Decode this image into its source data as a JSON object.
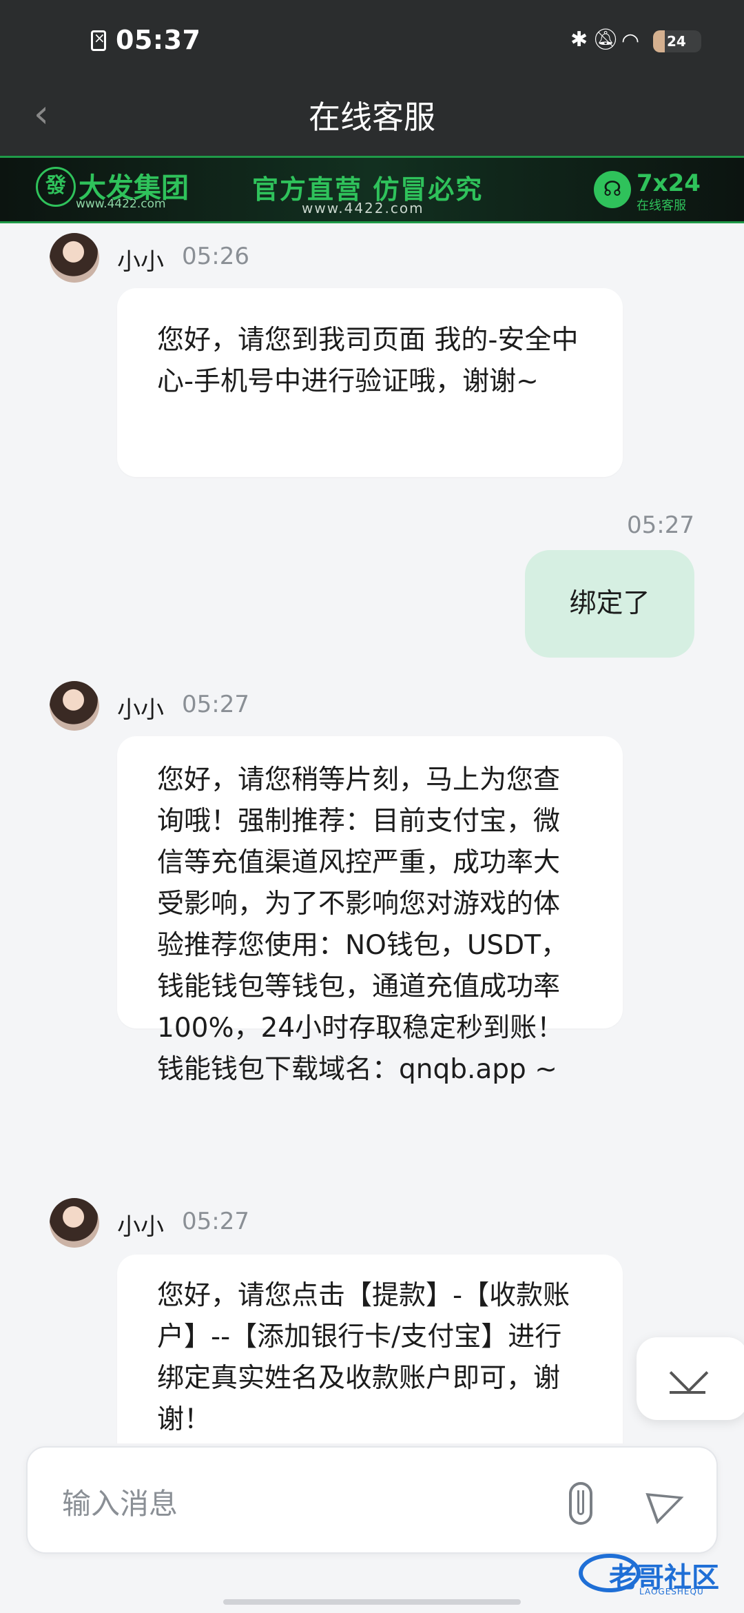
{
  "status_bar": {
    "time": "05:37",
    "battery_level": "24",
    "battery_fraction": 0.24,
    "icons": [
      "sim-icon",
      "bluetooth-icon",
      "bell-off-icon",
      "wifi-icon",
      "battery-icon"
    ]
  },
  "header": {
    "title": "在线客服",
    "back_icon": "chevron-left-icon"
  },
  "banner": {
    "logo_char": "發",
    "brand": "大发集团",
    "brand_url": "www.4422.com",
    "slogan": "官方直营  仿冒必究",
    "slogan_url": "www.4422.com",
    "service_top": "7x24",
    "service_bottom": "在线客服",
    "accent_color": "#2fc25b"
  },
  "messages": [
    {
      "direction": "in",
      "sender": "小小",
      "time": "05:26",
      "text": "您好，请您到我司页面 我的-安全中心-手机号中进行验证哦，谢谢~"
    },
    {
      "direction": "out",
      "time": "05:27",
      "text": "绑定了"
    },
    {
      "direction": "in",
      "sender": "小小",
      "time": "05:27",
      "text": "您好，请您稍等片刻，马上为您查询哦！强制推荐：目前支付宝，微信等充值渠道风控严重，成功率大受影响，为了不影响您对游戏的体验推荐您使用：NO钱包，USDT，钱能钱包等钱包，通道充值成功率100%，24小时存取稳定秒到账！ 钱能钱包下载域名：qnqb.app ~"
    },
    {
      "direction": "in",
      "sender": "小小",
      "time": "05:27",
      "text": "您好，请您点击【提款】-【收款账户】--【添加银行卡/支付宝】进行绑定真实姓名及收款账户即可，谢谢！"
    }
  ],
  "composer": {
    "placeholder": "输入消息",
    "attach_icon": "paperclip-icon",
    "send_icon": "send-icon"
  },
  "scroll_button_icon": "scroll-down-icon",
  "watermark": {
    "text": "老哥社区",
    "sub": "LAOGESHEQU"
  },
  "colors": {
    "header_bg": "#2b2d2e",
    "outgoing_bubble": "#d6efe2",
    "incoming_bubble": "#ffffff",
    "chat_bg": "#f4f5f7"
  }
}
